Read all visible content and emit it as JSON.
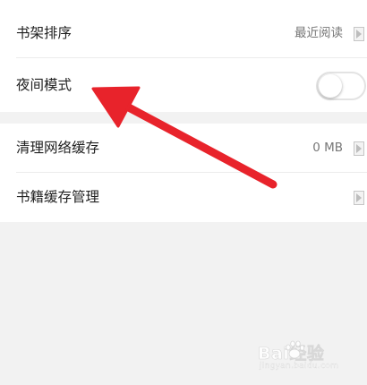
{
  "settings": {
    "shelf_sort": {
      "label": "书架排序",
      "value": "最近阅读"
    },
    "night_mode": {
      "label": "夜间模式",
      "enabled": false
    },
    "clear_network_cache": {
      "label": "清理网络缓存",
      "value": "0 MB"
    },
    "book_cache_manage": {
      "label": "书籍缓存管理"
    }
  },
  "annotation": {
    "color": "#e8232b"
  },
  "watermark": {
    "brand": "Bai经验",
    "domain": "jingyan.baidu.com"
  }
}
